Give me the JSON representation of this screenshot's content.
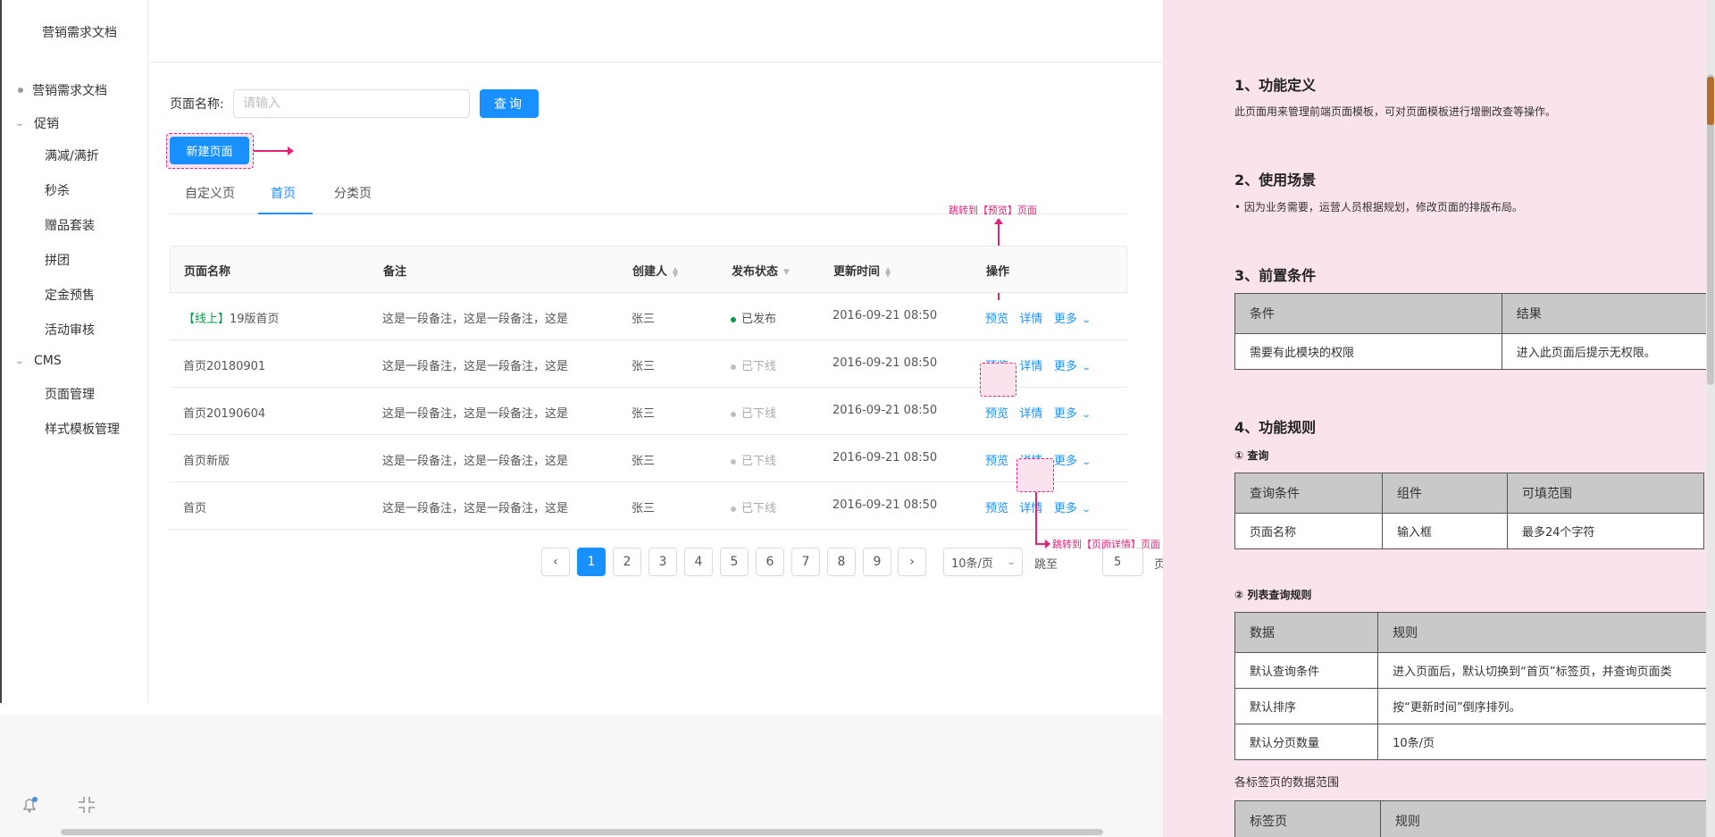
{
  "sidebar": {
    "title": "营销需求文档",
    "items": [
      {
        "label": "营销需求文档",
        "kind": "dot"
      },
      {
        "label": "促销",
        "kind": "group"
      },
      {
        "label": "满减/满折",
        "kind": "sub"
      },
      {
        "label": "秒杀",
        "kind": "sub"
      },
      {
        "label": "赠品套装",
        "kind": "sub"
      },
      {
        "label": "拼团",
        "kind": "sub"
      },
      {
        "label": "定金预售",
        "kind": "sub"
      },
      {
        "label": "活动审核",
        "kind": "sub"
      },
      {
        "label": "CMS",
        "kind": "group"
      },
      {
        "label": "页面管理",
        "kind": "sub"
      },
      {
        "label": "样式模板管理",
        "kind": "sub"
      }
    ]
  },
  "search": {
    "label": "页面名称:",
    "placeholder": "请输入",
    "button": "查询"
  },
  "new_page_button": "新建页面",
  "tabs": [
    "自定义页",
    "首页",
    "分类页"
  ],
  "annotations": {
    "preview": "跳转到【预览】页面",
    "detail": "跳转到【页面详情】页面"
  },
  "table": {
    "headers": [
      "页面名称",
      "备注",
      "创建人",
      "发布状态",
      "更新时间",
      "操作"
    ],
    "rows": [
      {
        "tag": "【线上】",
        "name": "19版首页",
        "note": "这是一段备注，这是一段备注，这是",
        "creator": "张三",
        "status": "已发布",
        "published": true,
        "time": "2016-09-21  08:50"
      },
      {
        "tag": "",
        "name": "首页20180901",
        "note": "这是一段备注，这是一段备注，这是",
        "creator": "张三",
        "status": "已下线",
        "published": false,
        "time": "2016-09-21  08:50"
      },
      {
        "tag": "",
        "name": "首页20190604",
        "note": "这是一段备注，这是一段备注，这是",
        "creator": "张三",
        "status": "已下线",
        "published": false,
        "time": "2016-09-21  08:50"
      },
      {
        "tag": "",
        "name": "首页新版",
        "note": "这是一段备注，这是一段备注，这是",
        "creator": "张三",
        "status": "已下线",
        "published": false,
        "time": "2016-09-21  08:50"
      },
      {
        "tag": "",
        "name": "首页",
        "note": "这是一段备注，这是一段备注，这是",
        "creator": "张三",
        "status": "已下线",
        "published": false,
        "time": "2016-09-21  08:50"
      }
    ],
    "actions": {
      "preview": "预览",
      "detail": "详情",
      "more": "更多"
    }
  },
  "pagination": {
    "pages": [
      "1",
      "2",
      "3",
      "4",
      "5",
      "6",
      "7",
      "8",
      "9"
    ],
    "current": "1",
    "page_size": "10条/页",
    "jump_label": "跳至",
    "jump_value": "5",
    "jump_unit": "页"
  },
  "doc": {
    "s1_title": "1、功能定义",
    "s1_text": "此页面用来管理前端页面模板，可对页面模板进行增删改查等操作。",
    "s2_title": "2、使用场景",
    "s2_text": "• 因为业务需要，运营人员根据规划，修改页面的排版布局。",
    "s3_title": "3、前置条件",
    "s3_table": {
      "headers": [
        "条件",
        "结果"
      ],
      "row": [
        "需要有此模块的权限",
        "进入此页面后提示无权限。"
      ]
    },
    "s4_title": "4、功能规则",
    "q_title": "① 查询",
    "q_table": {
      "headers": [
        "查询条件",
        "组件",
        "可填范围"
      ],
      "row": [
        "页面名称",
        "输入框",
        "最多24个字符"
      ]
    },
    "l_title": "② 列表查询规则",
    "l_table": {
      "headers": [
        "数据",
        "规则"
      ],
      "rows": [
        [
          "默认查询条件",
          "进入页面后，默认切换到“首页”标签页，并查询页面类"
        ],
        [
          "默认排序",
          "按“更新时间”倒序排列。"
        ],
        [
          "默认分页数量",
          "10条/页"
        ]
      ]
    },
    "tab_range_title": "各标签页的数据范围",
    "tab_table_headers": [
      "标签页",
      "规则"
    ]
  },
  "colors": {
    "primary": "#1890ff",
    "annotation": "#e6207a",
    "published": "#0a9a4a",
    "offline": "#bfbfbf",
    "doc_bg": "#fbe3ee"
  }
}
